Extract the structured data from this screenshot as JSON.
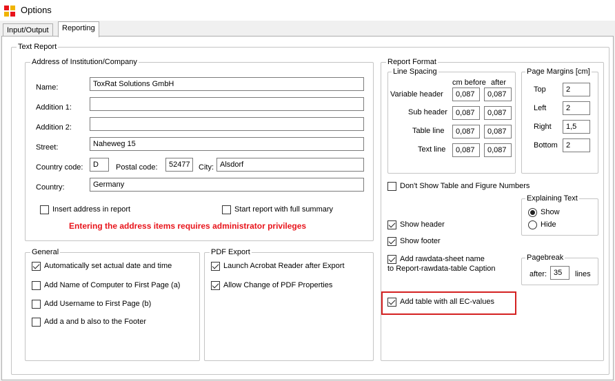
{
  "window": {
    "title": "Options"
  },
  "tabs": [
    {
      "label": "Input/Output"
    },
    {
      "label": "Reporting"
    }
  ],
  "text_report": {
    "legend": "Text Report",
    "address": {
      "legend": "Address of Institution/Company",
      "name_label": "Name:",
      "name_value": "ToxRat Solutions GmbH",
      "addition1_label": "Addition 1:",
      "addition1_value": "",
      "addition2_label": "Addition 2:",
      "addition2_value": "",
      "street_label": "Street:",
      "street_value": "Naheweg 15",
      "country_code_label": "Country code:",
      "country_code_value": "D",
      "postal_code_label": "Postal code:",
      "postal_code_value": "52477",
      "city_label": "City:",
      "city_value": "Alsdorf",
      "country_label": "Country:",
      "country_value": "Germany",
      "insert_address_label": "Insert address in report",
      "start_full_summary_label": "Start report with full  summary",
      "warning": "Entering the address items requires administrator privileges"
    },
    "general": {
      "legend": "General",
      "items": [
        {
          "label": "Automatically set actual date and time",
          "checked": true
        },
        {
          "label": "Add Name of Computer to First Page (a)",
          "checked": false
        },
        {
          "label": "Add Username to First Page (b)",
          "checked": false
        },
        {
          "label": "Add a and b also to the Footer",
          "checked": false
        }
      ]
    },
    "pdf_export": {
      "legend": "PDF Export",
      "items": [
        {
          "label": "Launch Acrobat Reader after Export",
          "checked": true
        },
        {
          "label": "Allow Change of PDF Properties",
          "checked": true
        }
      ]
    },
    "report_format": {
      "legend": "Report Format",
      "line_spacing": {
        "legend": "Line Spacing",
        "col_before": "cm before",
        "col_after": "after",
        "rows": [
          {
            "label": "Variable header",
            "before": "0,087",
            "after": "0,087"
          },
          {
            "label": "Sub header",
            "before": "0,087",
            "after": "0,087"
          },
          {
            "label": "Table line",
            "before": "0,087",
            "after": "0,087"
          },
          {
            "label": "Text line",
            "before": "0,087",
            "after": "0,087"
          }
        ]
      },
      "page_margins": {
        "legend": "Page Margins [cm]",
        "top_label": "Top",
        "top_value": "2",
        "left_label": "Left",
        "left_value": "2",
        "right_label": "Right",
        "right_value": "1,5",
        "bottom_label": "Bottom",
        "bottom_value": "2"
      },
      "dont_show_numbers_label": "Don't Show Table and Figure Numbers",
      "explaining_text": {
        "legend": "Explaining Text",
        "show_label": "Show",
        "hide_label": "Hide",
        "selected": "Show"
      },
      "show_header_label": "Show header",
      "show_footer_label": "Show footer",
      "add_rawdata_label_line1": "Add rawdata-sheet name",
      "add_rawdata_label_line2": "to Report-rawdata-table Caption",
      "pagebreak": {
        "legend": "Pagebreak",
        "after_label": "after:",
        "value": "35",
        "unit_label": "lines"
      },
      "add_table_ec_label": "Add table with all EC-values"
    }
  },
  "colors": {
    "warning": "#e8141b",
    "highlight": "#d42020"
  }
}
